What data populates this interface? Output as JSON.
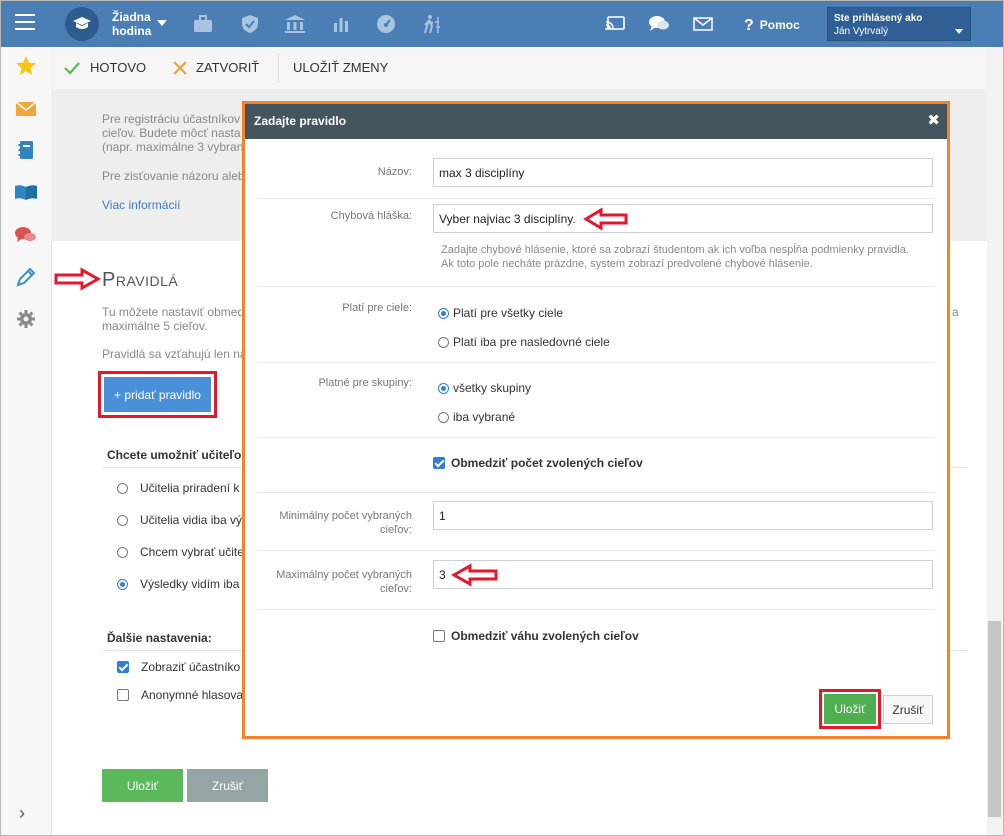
{
  "topbar": {
    "hodina_line1": "Žiadna",
    "hodina_line2": "hodina",
    "help_label": "Pomoc",
    "user_label": "Ste prihlásený ako",
    "user_name": "Ján Vytrvalý"
  },
  "toolbar": {
    "done_label": "HOTOVO",
    "close_label": "ZATVORIŤ",
    "save_changes_label": "ULOŽIŤ ZMENY"
  },
  "background": {
    "reg_text_1": "Pre registráciu účastníkov",
    "reg_text_2": "cieľov. Budete môcť nasta",
    "reg_text_3": "(napr. maximálne 3 vybran",
    "opinion_text": "Pre zisťovanie názoru aleb",
    "more_info_link": "Viac informácií",
    "rules_title": "Pravidlá",
    "rules_desc_1": "Tu môžete nastaviť obmed",
    "rules_desc_2": "maximálne 5 cieľov.",
    "rules_desc_right": "a",
    "rules_apply": "Pravidlá sa vzťahujú len na",
    "add_rule_button": "+ pridať pravidlo",
    "teachers_question": "Chcete umožniť učiteľo",
    "teacher_options": [
      "Učitelia priradení k",
      "Učitelia vidia iba vý",
      "Chcem vybrať učite",
      "Výsledky vidím iba"
    ],
    "other_settings": "Ďalšie nastavenia:",
    "other_options": [
      "Zobraziť účastníko",
      "Anonymné hlasova"
    ],
    "save_button": "Uložiť",
    "cancel_button": "Zrušiť"
  },
  "modal": {
    "title": "Zadajte pravidlo",
    "name_label": "Názov:",
    "name_value": "max 3 disciplíny",
    "error_label": "Chybová hláška:",
    "error_value": "Vyber najviac 3 disciplíny.",
    "error_hint": "Zadajte chybové hlásenie, ktoré sa zobrazí študentom ak ich voľba nespĺňa podmienky pravidla. Ak toto pole necháte prázdne, system zobrazí predvolené chybové hlásenie.",
    "goals_label": "Platí pre ciele:",
    "goals_all": "Platí pre všetky ciele",
    "goals_specific": "Platí iba pre nasledovné ciele",
    "groups_label": "Platné pre skupiny:",
    "groups_all": "všetky skupiny",
    "groups_selected": "iba vybrané",
    "limit_count_label": "Obmedziť počet zvolených cieľov",
    "min_label": "Minimálny počet vybraných cieľov:",
    "min_value": "1",
    "max_label": "Maximálny počet vybraných cieľov:",
    "max_value": "3",
    "limit_weight_label": "Obmedziť váhu zvolených cieľov",
    "save_button": "Uložiť",
    "cancel_button": "Zrušiť"
  },
  "colors": {
    "topbar": "#4a7eb5",
    "modal_header": "#44555e",
    "modal_border": "#f5822a",
    "annotation_red": "#e3182c",
    "primary_button": "#4a90d9",
    "success_button": "#5cb85c"
  }
}
